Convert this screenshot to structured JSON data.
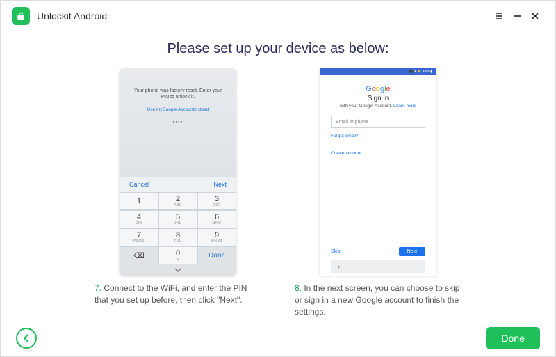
{
  "titlebar": {
    "app_name": "Unlockit Android"
  },
  "heading": "Please set up your device as below:",
  "phone1": {
    "message": "Your phone was factory reset. Enter your PIN to unlock it.",
    "alt_link": "Use myGoogle Accountinstead",
    "pin_dots": "••••",
    "cancel": "Cancel",
    "next": "Next",
    "keys": {
      "k1": "1",
      "k2": "2",
      "k2s": "ABC",
      "k3": "3",
      "k3s": "DEF",
      "k4": "4",
      "k4s": "GHI",
      "k5": "5",
      "k5s": "JKL",
      "k6": "6",
      "k6s": "MNO",
      "k7": "7",
      "k7s": "PQRS",
      "k8": "8",
      "k8s": "TUV",
      "k9": "9",
      "k9s": "WXYZ",
      "kx": "⌫",
      "k0": "0",
      "k0s": "+",
      "kd": "Done"
    }
  },
  "phone2": {
    "status": "⚫ ▾ ⚡ 43% ▮",
    "signin": "Sign in",
    "sub_pre": "with your Google Account. ",
    "sub_link": "Learn more",
    "placeholder": "Email or phone",
    "forgot": "Forgot email?",
    "create": "Create account",
    "skip": "Skip",
    "next": "Next",
    "back": "‹"
  },
  "captions": {
    "c1_num": "7.",
    "c1_text": " Connect to the WiFi, and enter the PIN that you set up before, then click \"Next\".",
    "c2_num": "8.",
    "c2_text": " In the next screen, you can choose to skip or sign in a new Google account to finish the settings."
  },
  "footer": {
    "done": "Done"
  }
}
